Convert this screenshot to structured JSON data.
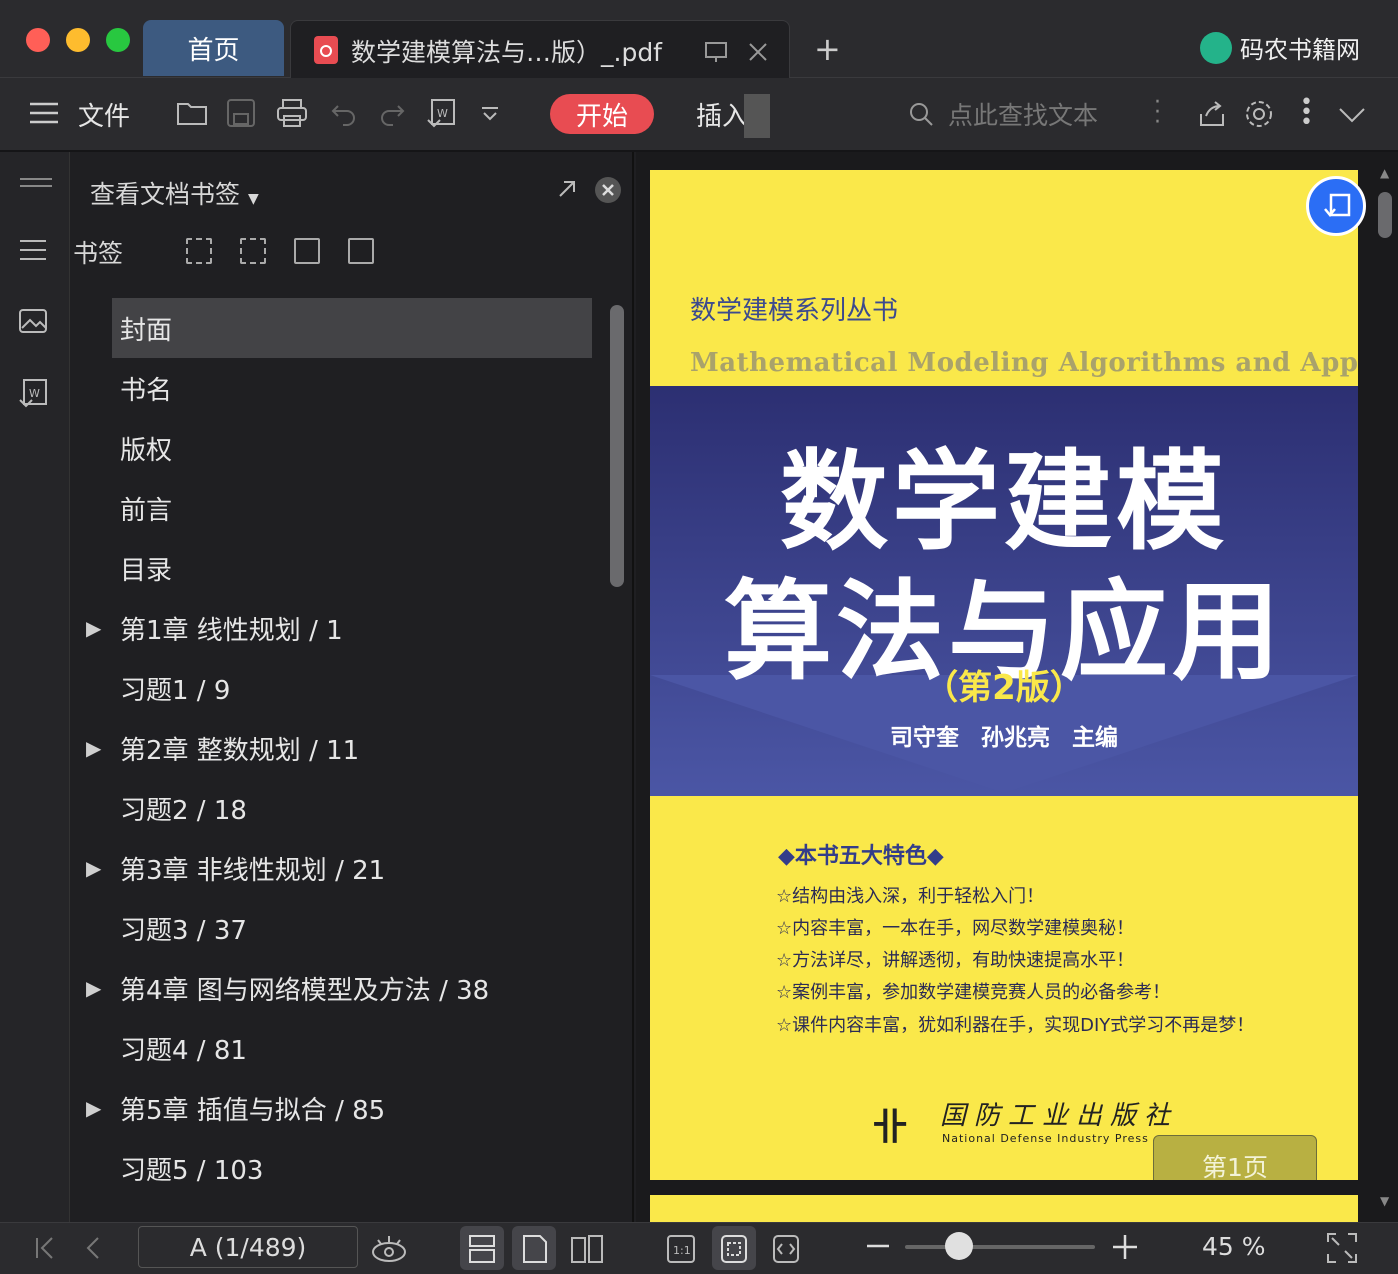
{
  "window": {
    "tabs": [
      {
        "label": "首页"
      },
      {
        "label": "数学建模算法与…版）_.pdf"
      }
    ],
    "brand": "码农书籍网"
  },
  "toolbar": {
    "menu_label": "文件",
    "start_label": "开始",
    "insert_label": "插入",
    "search_placeholder": "点此查找文本"
  },
  "panel": {
    "header": "查看文档书签",
    "bookmarks_label": "书签",
    "items": [
      {
        "label": "封面",
        "expandable": false,
        "selected": true
      },
      {
        "label": "书名",
        "expandable": false
      },
      {
        "label": "版权",
        "expandable": false
      },
      {
        "label": "前言",
        "expandable": false
      },
      {
        "label": "目录",
        "expandable": false
      },
      {
        "label": "第1章 线性规划 / 1",
        "expandable": true
      },
      {
        "label": "习题1 / 9",
        "expandable": false
      },
      {
        "label": "第2章 整数规划 / 11",
        "expandable": true
      },
      {
        "label": "习题2 / 18",
        "expandable": false
      },
      {
        "label": "第3章 非线性规划 / 21",
        "expandable": true
      },
      {
        "label": "习题3 / 37",
        "expandable": false
      },
      {
        "label": "第4章 图与网络模型及方法 / 38",
        "expandable": true
      },
      {
        "label": "习题4 / 81",
        "expandable": false
      },
      {
        "label": "第5章 插值与拟合 / 85",
        "expandable": true
      },
      {
        "label": "习题5 / 103",
        "expandable": false
      }
    ]
  },
  "cover": {
    "series": "数学建模系列丛书",
    "english_title": "Mathematical Modeling Algorithms and Applications",
    "title_line1": "数学建模",
    "title_line2": "算法与应用",
    "edition": "（第2版）",
    "authors": "司守奎 孙兆亮 主编",
    "features_title": "◆本书五大特色◆",
    "features": [
      "☆结构由浅入深，利于轻松入门！",
      "☆内容丰富，一本在手，网尽数学建模奥秘！",
      "☆方法详尽，讲解透彻，有助快速提高水平！",
      "☆案例丰富，参加数学建模竞赛人员的必备参考！",
      "☆课件内容丰富，犹如利器在手，实现DIY式学习不再是梦！"
    ],
    "publisher": "国防工业出版社",
    "publisher_en": "National Defense Industry Press",
    "page_badge": "第1页"
  },
  "statusbar": {
    "page_indicator": "A (1/489)",
    "zoom": "45 %"
  },
  "colors": {
    "accent_red": "#e84c52",
    "home_tab": "#3d5a80",
    "cover_yellow": "#fae84a",
    "cover_blue": "#2c2f72",
    "fab_blue": "#2b6ef5"
  }
}
